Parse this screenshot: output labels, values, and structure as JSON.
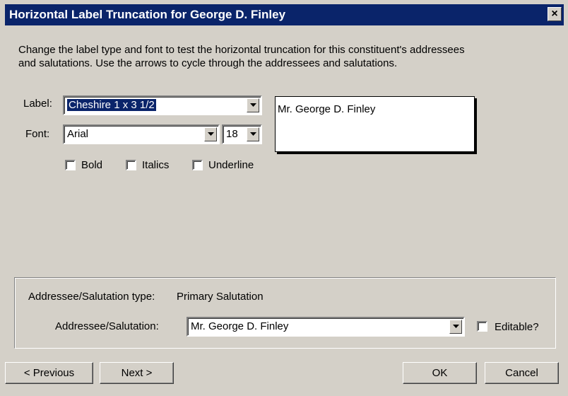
{
  "window": {
    "title": "Horizontal Label Truncation for George D. Finley",
    "close_label": "×"
  },
  "description": {
    "line1": "Change the label type and font to test the horizontal truncation for this constituent's addressees",
    "line2": "and salutations.  Use the arrows to cycle through the addressees and salutations."
  },
  "label_field": {
    "label": "Label:",
    "value": "Cheshire 1 x 3 1/2"
  },
  "font_field": {
    "label": "Font:",
    "value": "Arial",
    "size": "18"
  },
  "styles": {
    "bold": "Bold",
    "italics": "Italics",
    "underline": "Underline"
  },
  "preview": {
    "text": "Mr. George D. Finley"
  },
  "addressee": {
    "type_label": "Addressee/Salutation type:",
    "type_value": "Primary Salutation",
    "field_label": "Addressee/Salutation:",
    "field_value": "Mr. George D. Finley",
    "editable_label": "Editable?"
  },
  "buttons": {
    "previous": "< Previous",
    "next": "Next >",
    "ok": "OK",
    "cancel": "Cancel"
  },
  "colors": {
    "titlebar": "#0a246a",
    "dialog": "#d4d0c8",
    "selection": "#0a246a"
  }
}
